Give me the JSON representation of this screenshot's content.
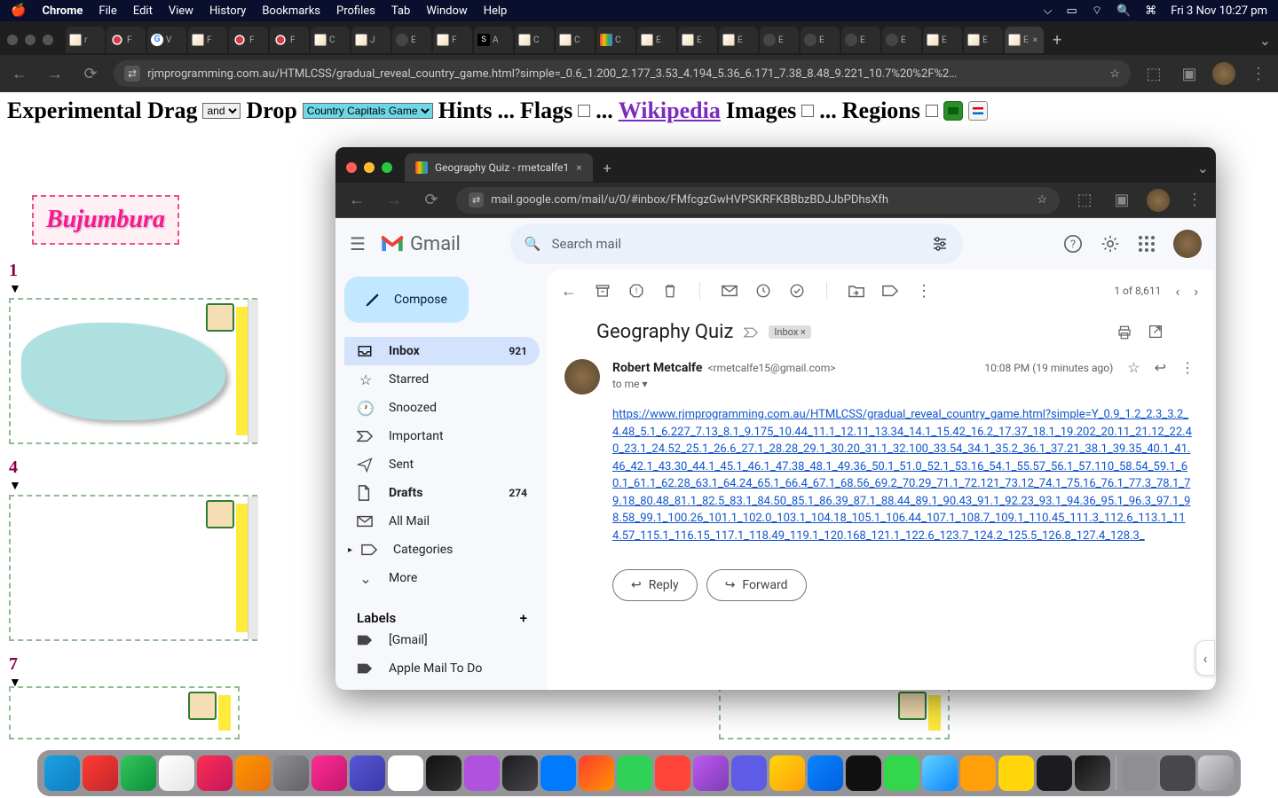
{
  "menubar": {
    "app": "Chrome",
    "items": [
      "File",
      "Edit",
      "View",
      "History",
      "Bookmarks",
      "Profiles",
      "Tab",
      "Window",
      "Help"
    ],
    "clock": "Fri 3 Nov  10:27 pm"
  },
  "chrome1": {
    "url": "rjmprogramming.com.au/HTMLCSS/gradual_reveal_country_game.html?simple=_0.6_1.200_2.177_3.53_4.194_5.36_6.171_7.38_8.48_9.221_10.7%20%2F%2…",
    "tabs": [
      "r",
      "F",
      "V",
      "F",
      "F",
      "F",
      "C",
      "J",
      "E",
      "F",
      "A",
      "C",
      "C",
      "C",
      "E",
      "E",
      "E",
      "E",
      "E",
      "E",
      "E",
      "E",
      "E",
      "E"
    ]
  },
  "page": {
    "title_parts": {
      "a": "Experimental Drag",
      "b": "Drop",
      "hints": "Hints",
      "dots": "...",
      "flags": "Flags",
      "wiki": "Wikipedia",
      "images": "Images",
      "regions": "Regions"
    },
    "sel_and": "and",
    "sel_game": "Country Capitals Game",
    "bujumbura": "Bujumbura",
    "card_nums": [
      "1",
      "4",
      "7"
    ]
  },
  "chrome2": {
    "tab_title": "Geography Quiz - rmetcalfe1",
    "url": "mail.google.com/mail/u/0/#inbox/FMfcgzGwHVPSKRFKBBbzBDJJbPDhsXfh"
  },
  "gmail": {
    "logo": "Gmail",
    "search_placeholder": "Search mail",
    "compose": "Compose",
    "sidebar": [
      {
        "icon": "inbox",
        "label": "Inbox",
        "count": "921",
        "active": true
      },
      {
        "icon": "star",
        "label": "Starred"
      },
      {
        "icon": "clock",
        "label": "Snoozed"
      },
      {
        "icon": "important",
        "label": "Important"
      },
      {
        "icon": "send",
        "label": "Sent"
      },
      {
        "icon": "draft",
        "label": "Drafts",
        "count": "274"
      },
      {
        "icon": "mail",
        "label": "All Mail"
      },
      {
        "icon": "cat",
        "label": "Categories",
        "expand": true
      },
      {
        "icon": "more",
        "label": "More"
      }
    ],
    "labels_header": "Labels",
    "labels": [
      "[Gmail]",
      "Apple Mail To Do"
    ],
    "counter": "1 of 8,611",
    "subject": "Geography Quiz",
    "inbox_chip": "Inbox",
    "sender_name": "Robert Metcalfe",
    "sender_email": "<rmetcalfe15@gmail.com>",
    "timestamp": "10:08 PM (19 minutes ago)",
    "to_line": "to me",
    "body_link": "https://www.rjmprogramming.com.au/HTMLCSS/gradual_reveal_country_game.html?simple=Y_0.9_1.2_2.3_3.2_4.48_5.1_6.227_7.13_8.1_9.175_10.44_11.1_12.11_13.34_14.1_15.42_16.2_17.37_18.1_19.202_20.11_21.12_22.40_23.1_24.52_25.1_26.6_27.1_28.28_29.1_30.20_31.1_32.100_33.54_34.1_35.2_36.1_37.21_38.1_39.35_40.1_41.46_42.1_43.30_44.1_45.1_46.1_47.38_48.1_49.36_50.1_51.0_52.1_53.16_54.1_55.57_56.1_57.110_58.54_59.1_60.1_61.1_62.28_63.1_64.24_65.1_66.4_67.1_68.56_69.2_70.29_71.1_72.121_73.12_74.1_75.16_76.1_77.3_78.1_79.18_80.48_81.1_82.5_83.1_84.50_85.1_86.39_87.1_88.44_89.1_90.43_91.1_92.23_93.1_94.36_95.1_96.3_97.1_98.58_99.1_100.26_101.1_102.0_103.1_104.18_105.1_106.44_107.1_108.7_109.1_110.45_111.3_112.6_113.1_114.57_115.1_116.15_117.1_118.49_119.1_120.168_121.1_122.6_123.7_124.2_125.5_126.8_127.4_128.3_",
    "reply": "Reply",
    "forward": "Forward"
  }
}
